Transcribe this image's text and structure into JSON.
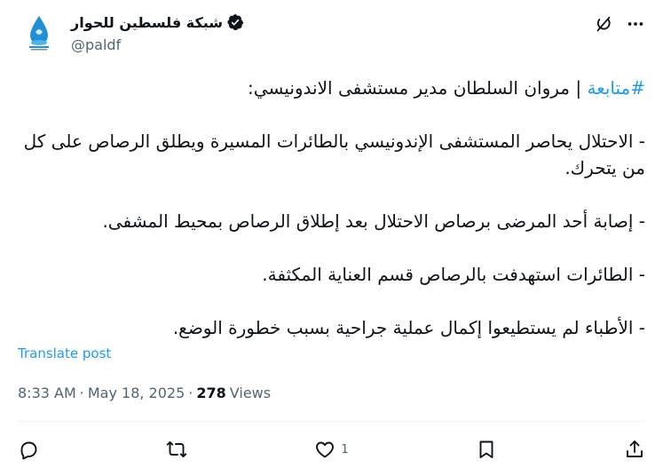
{
  "author": {
    "display_name": "شبكة فلسطين للحوار",
    "handle": "@paldf",
    "verified": true,
    "avatar_icon": "paldf-logo-icon"
  },
  "top_actions": [
    "grok-icon",
    "more-icon"
  ],
  "post": {
    "hashtag": "#متابعة",
    "headline": " | مروان السلطان مدير مستشفى الاندونيسي:",
    "lines": [
      "-  الاحتلال يحاصر المستشفى الإندونيسي بالطائرات المسيرة ويطلق الرصاص على كل من يتحرك.",
      "- إصابة أحد المرضى برصاص الاحتلال بعد إطلاق الرصاص بمحيط المشفى.",
      "- الطائرات استهدفت بالرصاص قسم العناية المكثفة.",
      "- الأطباء لم يستطيعوا إكمال عملية جراحية بسبب خطورة الوضع."
    ]
  },
  "translate_label": "Translate post",
  "meta": {
    "time": "8:33 AM",
    "separator": "·",
    "date": "May 18, 2025",
    "views_count": "278",
    "views_label": "Views"
  },
  "actions": {
    "reply_icon": "reply-icon",
    "repost_icon": "repost-icon",
    "like_icon": "heart-icon",
    "like_count": "1",
    "bookmark_icon": "bookmark-icon",
    "share_icon": "share-icon"
  },
  "colors": {
    "link": "#1d9bf0",
    "text": "#0f1419",
    "secondary": "#536471"
  }
}
